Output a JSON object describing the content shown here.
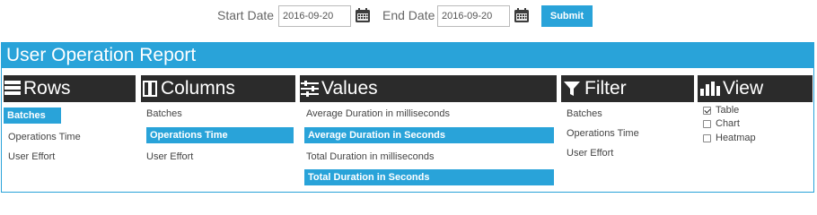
{
  "toolbar": {
    "start_date_label": "Start Date",
    "start_date_value": "2016-09-20",
    "end_date_label": "End Date",
    "end_date_value": "2016-09-20",
    "calendar_icon": "calendar-icon",
    "submit_label": "Submit"
  },
  "report": {
    "title": "User Operation Report",
    "accent_color": "#29a3d9",
    "header_color": "#2b2b2b",
    "rows": {
      "icon": "rows-icon",
      "title": "Rows",
      "items": [
        {
          "label": "Batches",
          "selected": true
        },
        {
          "label": "Operations Time",
          "selected": false
        },
        {
          "label": "User Effort",
          "selected": false
        }
      ]
    },
    "columns": {
      "icon": "columns-icon",
      "title": "Columns",
      "items": [
        {
          "label": "Batches",
          "selected": false
        },
        {
          "label": "Operations Time",
          "selected": true
        },
        {
          "label": "User Effort",
          "selected": false
        }
      ]
    },
    "values": {
      "icon": "sliders-icon",
      "title": "Values",
      "items": [
        {
          "label": "Average Duration in milliseconds",
          "selected": false
        },
        {
          "label": "Average Duration in Seconds",
          "selected": true
        },
        {
          "label": "Total Duration in milliseconds",
          "selected": false
        },
        {
          "label": "Total Duration in Seconds",
          "selected": true
        }
      ]
    },
    "filter": {
      "icon": "filter-icon",
      "title": "Filter",
      "items": [
        {
          "label": "Batches"
        },
        {
          "label": "Operations Time"
        },
        {
          "label": "User Effort"
        }
      ]
    },
    "view": {
      "icon": "bar-chart-icon",
      "title": "View",
      "options": [
        {
          "label": "Table",
          "checked": true
        },
        {
          "label": "Chart",
          "checked": false
        },
        {
          "label": "Heatmap",
          "checked": false
        }
      ]
    }
  }
}
